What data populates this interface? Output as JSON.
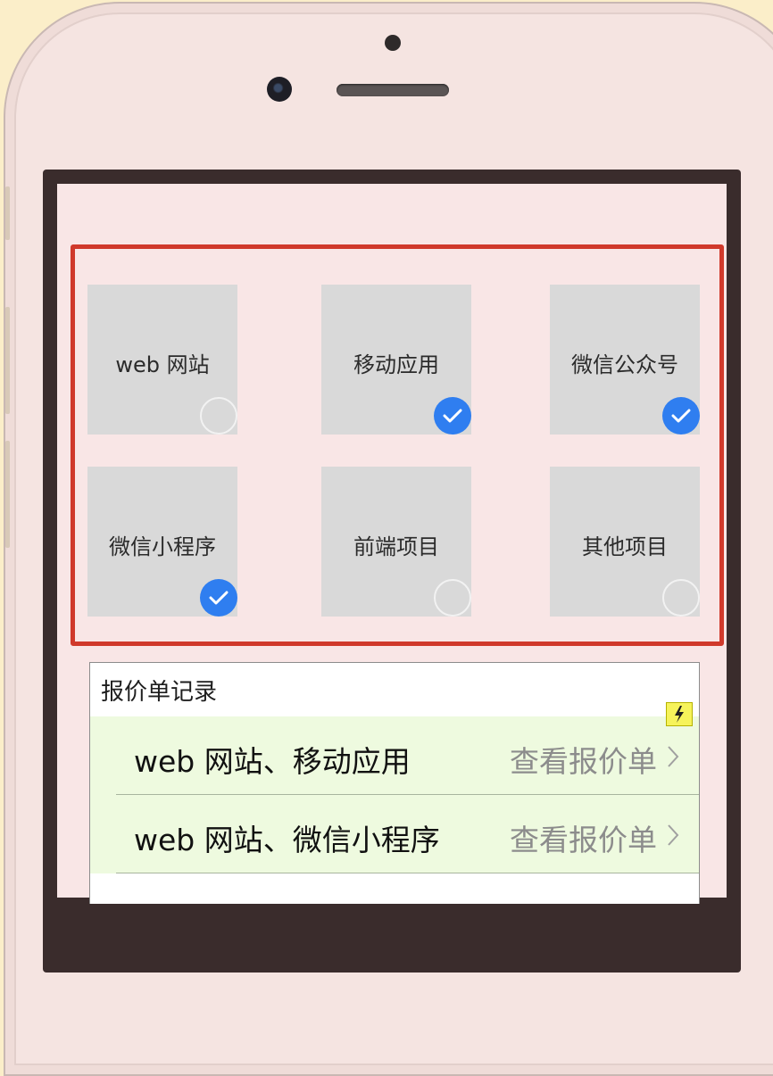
{
  "project_types": [
    {
      "label": "web 网站",
      "checked": false
    },
    {
      "label": "移动应用",
      "checked": true
    },
    {
      "label": "微信公众号",
      "checked": true
    },
    {
      "label": "微信小程序",
      "checked": true
    },
    {
      "label": "前端项目",
      "checked": false
    },
    {
      "label": "其他项目",
      "checked": false
    }
  ],
  "records": {
    "title": "报价单记录",
    "items": [
      {
        "name": "web 网站、移动应用",
        "action": "查看报价单"
      },
      {
        "name": "web 网站、微信小程序",
        "action": "查看报价单"
      }
    ]
  },
  "colors": {
    "accent": "#2f7ef0",
    "highlight_border": "#d0392b",
    "row_background": "#eefadf"
  },
  "icons": {
    "check": "checkmark-circle-icon",
    "flash": "lightning-icon",
    "chevron": "chevron-right-icon"
  }
}
